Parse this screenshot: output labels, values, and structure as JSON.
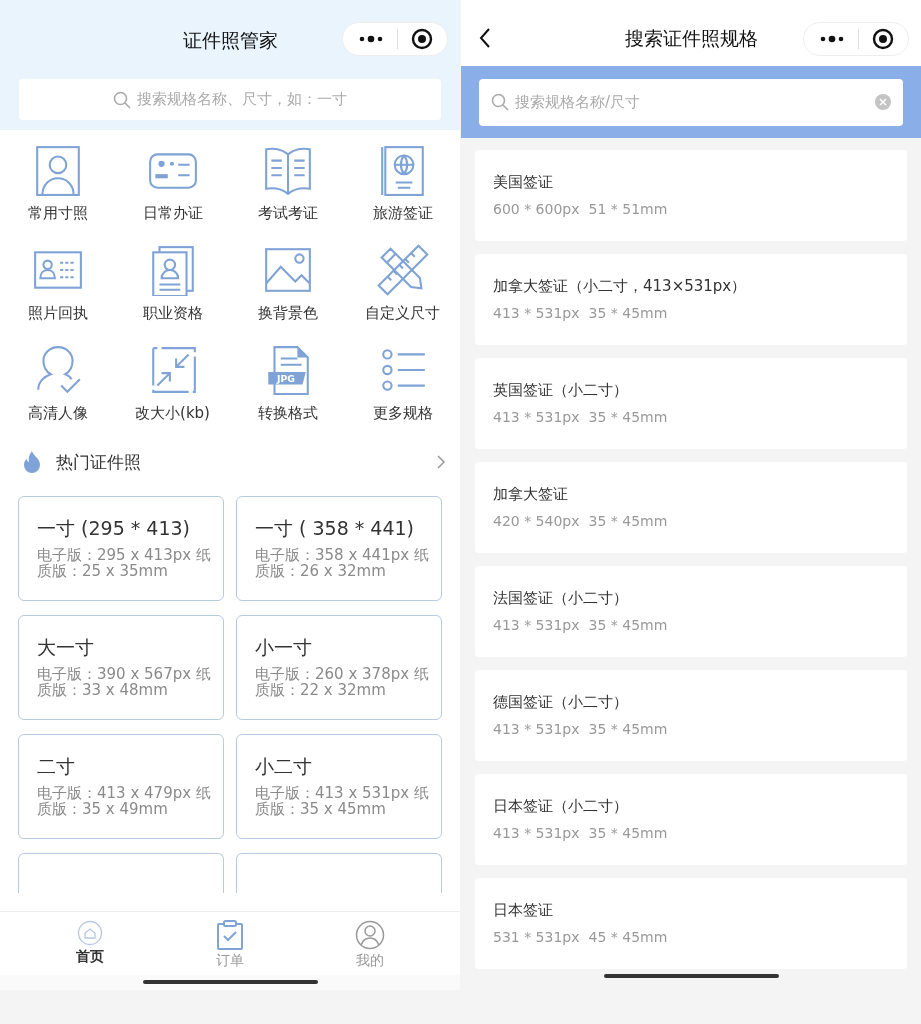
{
  "home": {
    "title": "证件照管家",
    "search": {
      "placeholder": "搜索规格名称、尺寸，如：一寸"
    },
    "categories": [
      {
        "label": "常用寸照"
      },
      {
        "label": "日常办证"
      },
      {
        "label": "考试考证"
      },
      {
        "label": "旅游签证"
      },
      {
        "label": "照片回执"
      },
      {
        "label": "职业资格"
      },
      {
        "label": "换背景色"
      },
      {
        "label": "自定义尺寸"
      },
      {
        "label": "高清人像"
      },
      {
        "label": "改大小(kb)"
      },
      {
        "label": "转换格式",
        "icon_text": "JPG"
      },
      {
        "label": "更多规格"
      }
    ],
    "hot_section": {
      "title": "热门证件照"
    },
    "hot_specs": [
      {
        "kind": "spec",
        "name": "一寸 (295 * 413)",
        "detail": "电子版：295 x 413px 纸质版：25 x 35mm"
      },
      {
        "kind": "spec",
        "name": "一寸 ( 358 * 441)",
        "detail": "电子版：358 x 441px 纸质版：26 x 32mm"
      },
      {
        "kind": "spec",
        "name": "大一寸",
        "detail": "电子版：390 x 567px 纸质版：33 x 48mm"
      },
      {
        "kind": "spec",
        "name": "小一寸",
        "detail": "电子版：260 x 378px 纸质版：22 x 32mm"
      },
      {
        "kind": "spec",
        "name": "二寸",
        "detail": "电子版：413 x 479px 纸质版：35 x 49mm"
      },
      {
        "kind": "spec",
        "name": "小二寸",
        "detail": "电子版：413 x 531px 纸质版：35 x 45mm"
      },
      {
        "kind": "cut"
      },
      {
        "kind": "cut"
      }
    ],
    "tab_bar": [
      {
        "label": "首页",
        "selected": true
      },
      {
        "label": "订单",
        "selected": false
      },
      {
        "label": "我的",
        "selected": false
      }
    ]
  },
  "search_page": {
    "title": "搜索证件照规格",
    "search": {
      "placeholder": "搜索规格名称/尺寸"
    },
    "results": [
      {
        "name": "美国签证",
        "pixels": "600 * 600px",
        "millimeters": "51 * 51mm"
      },
      {
        "name": "加拿大签证（小二寸，413×531px）",
        "pixels": "413 * 531px",
        "millimeters": "35 * 45mm"
      },
      {
        "name": "英国签证（小二寸）",
        "pixels": "413 * 531px",
        "millimeters": "35 * 45mm"
      },
      {
        "name": "加拿大签证",
        "pixels": "420 * 540px",
        "millimeters": "35 * 45mm"
      },
      {
        "name": "法国签证（小二寸）",
        "pixels": "413 * 531px",
        "millimeters": "35 * 45mm"
      },
      {
        "name": "德国签证（小二寸）",
        "pixels": "413 * 531px",
        "millimeters": "35 * 45mm"
      },
      {
        "name": "日本签证（小二寸）",
        "pixels": "413 * 531px",
        "millimeters": "35 * 45mm"
      },
      {
        "name": "日本签证",
        "pixels": "531 * 531px",
        "millimeters": "45 * 45mm"
      }
    ]
  }
}
